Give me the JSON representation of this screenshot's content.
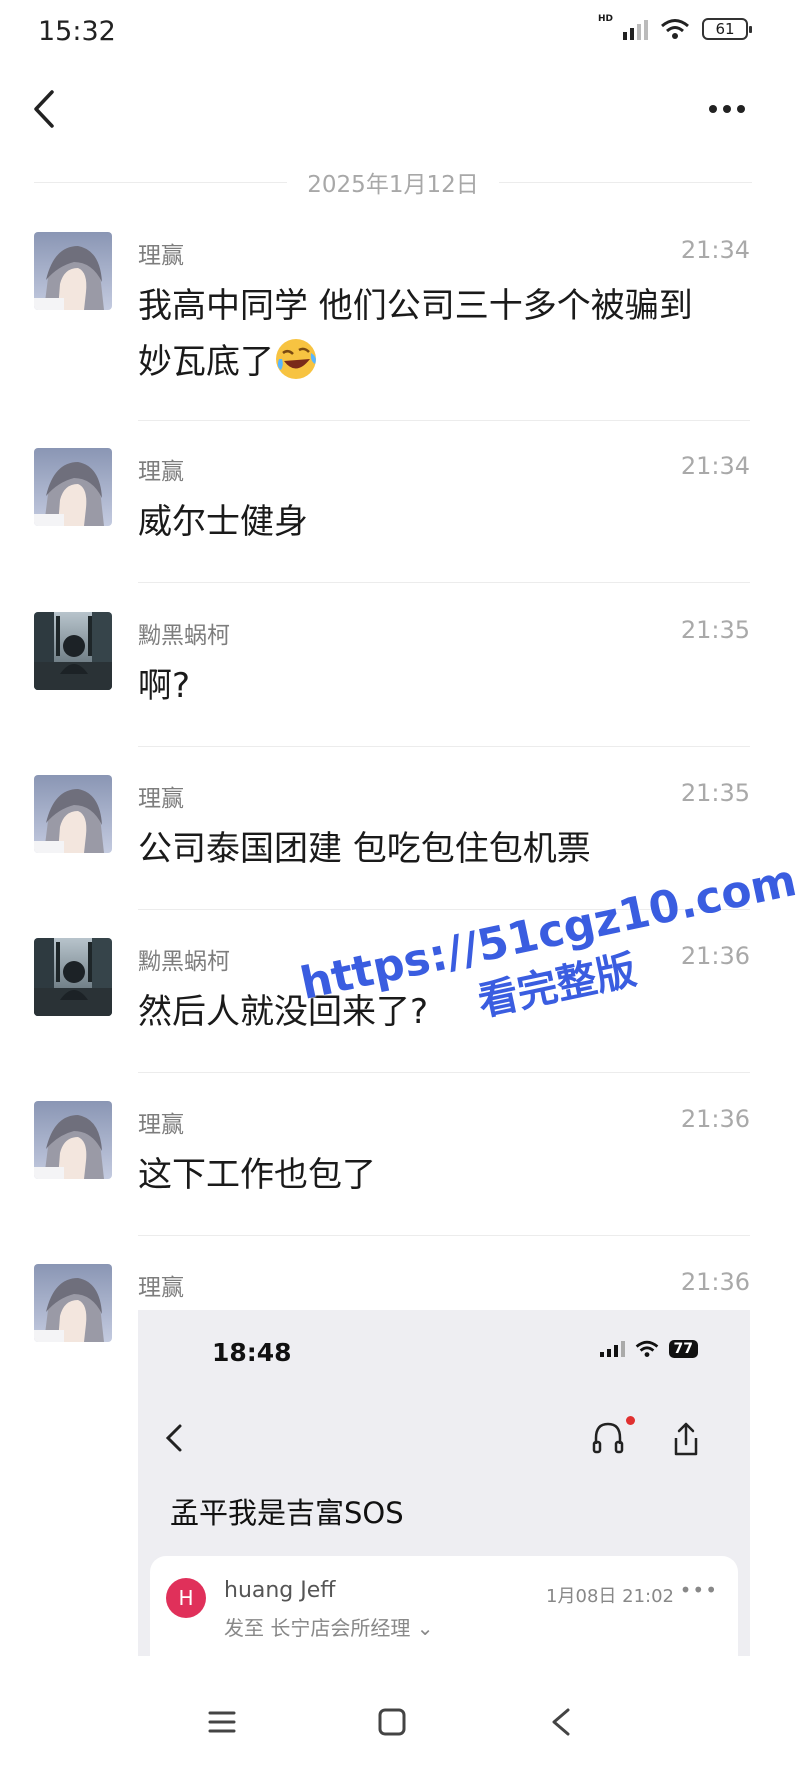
{
  "status_bar": {
    "time": "15:32",
    "hd_label": "HD",
    "battery": "61"
  },
  "nav": {
    "back_icon": "chevron-left-icon",
    "more_icon": "more-horizontal-icon"
  },
  "date_divider": "2025年1月12日",
  "messages": [
    {
      "sender": "理赢",
      "time": "21:34",
      "text": "我高中同学 他们公司三十多个被骗到",
      "text2": "妙瓦底了",
      "emoji": "rolling-on-floor-laughing-icon"
    },
    {
      "sender": "理赢",
      "time": "21:34",
      "text": "威尔士健身"
    },
    {
      "sender": "黝黑蜗柯",
      "time": "21:35",
      "text": "啊?"
    },
    {
      "sender": "理赢",
      "time": "21:35",
      "text": "公司泰国团建 包吃包住包机票"
    },
    {
      "sender": "黝黑蜗柯",
      "time": "21:36",
      "text": "然后人就没回来了?"
    },
    {
      "sender": "理赢",
      "time": "21:36",
      "text": "这下工作也包了"
    },
    {
      "sender": "理赢",
      "time": "21:36"
    }
  ],
  "embedded": {
    "time": "18:48",
    "battery": "77",
    "title": "孟平我是吉富SOS",
    "avatar_letter": "H",
    "from": "huang Jeff",
    "date": "1月08日 21:02",
    "more": "•••",
    "to": "发至 长宁店会所经理 ⌄"
  },
  "watermark": {
    "url": "https://51cgz10.com",
    "sub": "看完整版"
  },
  "bottom_nav": {
    "menu": "menu-icon",
    "home": "home-square-icon",
    "back": "back-triangle-icon"
  }
}
